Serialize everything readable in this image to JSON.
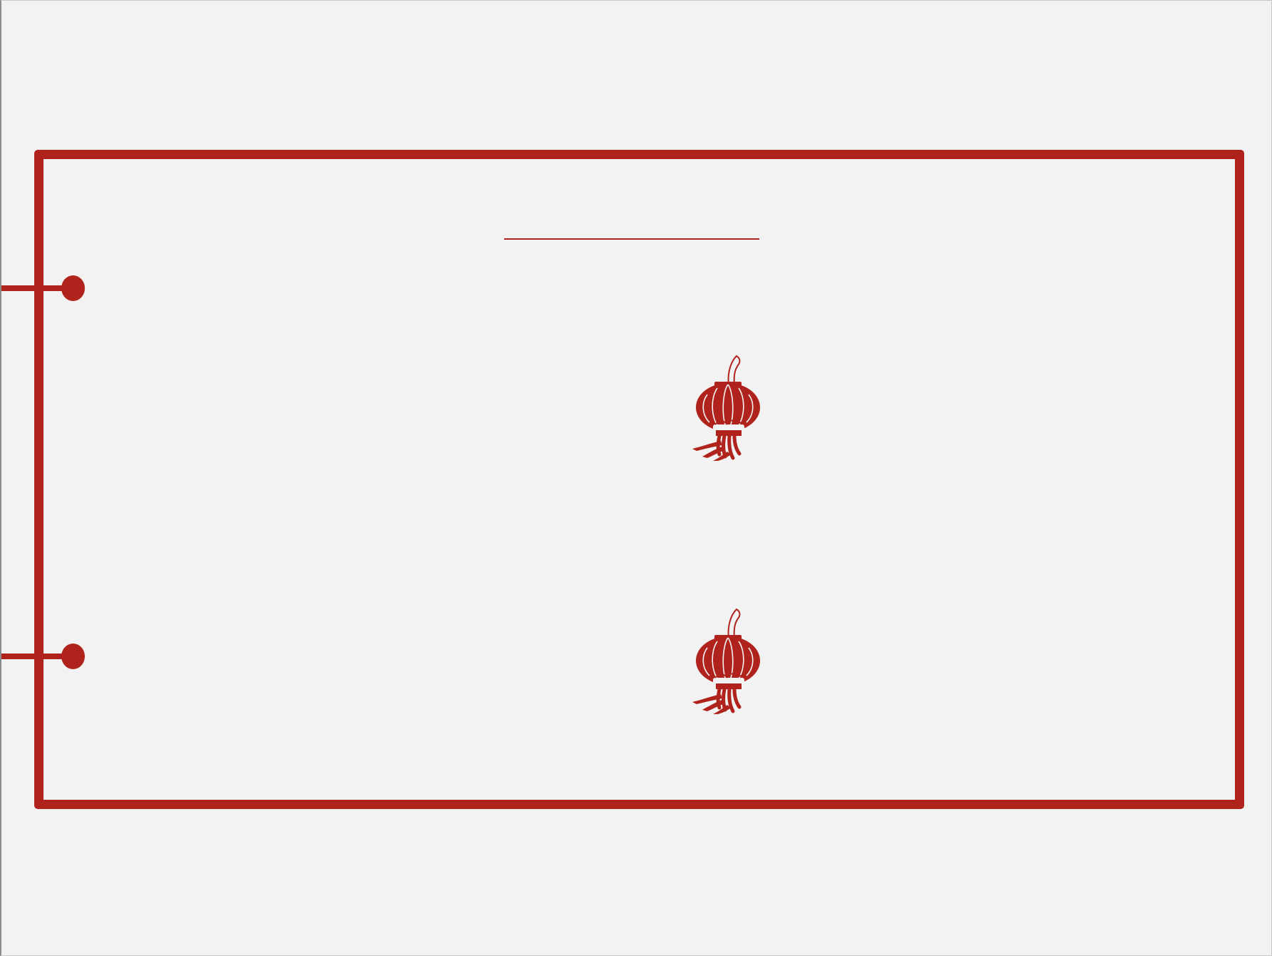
{
  "slide": {
    "title": "",
    "subtitle": "",
    "body": ""
  },
  "colors": {
    "accent": "#b0231d",
    "background": "#f2f2f2"
  },
  "decorations": {
    "lantern_icon": "lantern-icon",
    "binding_knot": "binding-knot-icon"
  }
}
